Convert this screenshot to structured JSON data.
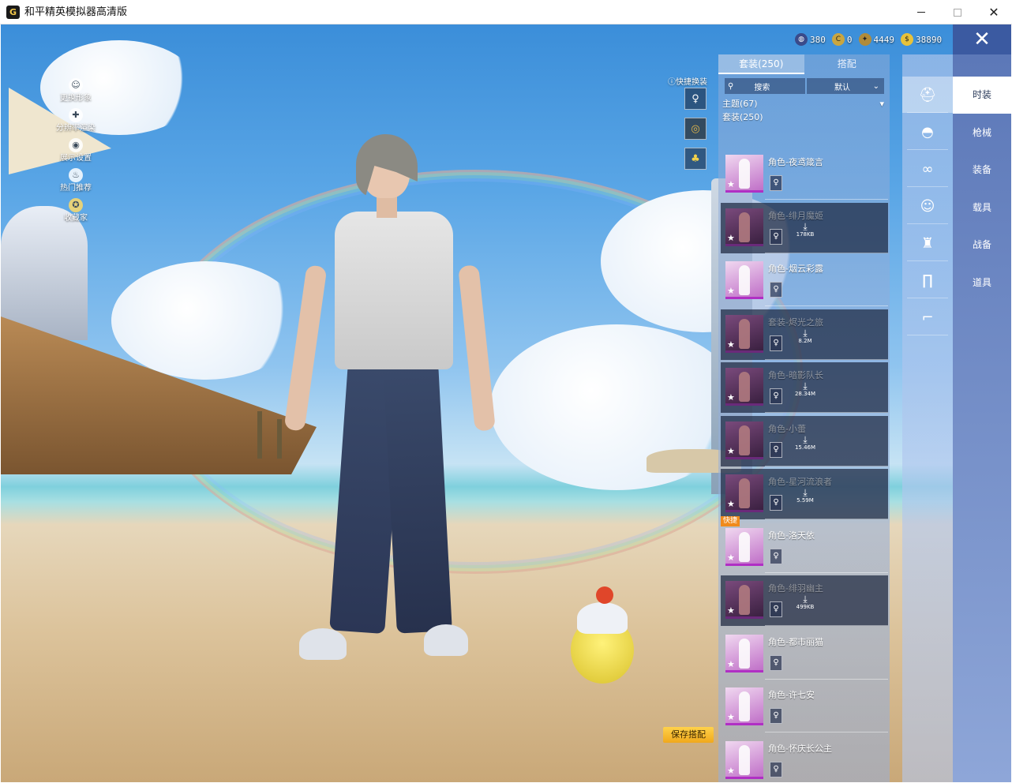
{
  "window": {
    "title": "和平精英模拟器高清版",
    "controls": {
      "minimize": "—",
      "maximize": "",
      "close": "✕"
    }
  },
  "left_menu": [
    {
      "label": "更换形象",
      "icon": "person-icon"
    },
    {
      "label": "分辨率渲染",
      "icon": "puzzle-icon"
    },
    {
      "label": "展示设置",
      "icon": "eye-icon"
    },
    {
      "label": "热门推荐",
      "icon": "flame-icon"
    },
    {
      "label": "收藏家",
      "icon": "collector-badge-icon"
    }
  ],
  "currencies": [
    {
      "value": "380",
      "icon": "globe-coin-icon",
      "color": "#3a4a8a"
    },
    {
      "value": "0",
      "icon": "c-coin-icon",
      "color": "#c9a640"
    },
    {
      "value": "4449",
      "icon": "medal-coin-icon",
      "color": "#b08b3a"
    },
    {
      "value": "38890",
      "icon": "gold-coin-icon",
      "color": "#e8c23a"
    }
  ],
  "quick_change": {
    "label": "快捷换装"
  },
  "panel": {
    "tabs": [
      "套装(250)",
      "搭配"
    ],
    "search_label": "搜索",
    "sort_label": "默认",
    "filter_theme": "主题(67)",
    "filter_suit": "套装(250)"
  },
  "outfits": [
    {
      "name": "角色-夜鸢箴言",
      "downloaded": true,
      "size": ""
    },
    {
      "name": "角色-绯月魔姬",
      "downloaded": false,
      "size": "178KB"
    },
    {
      "name": "角色-烟云彩露",
      "downloaded": true,
      "size": ""
    },
    {
      "name": "套装-烬光之旅",
      "downloaded": false,
      "size": "8.2M"
    },
    {
      "name": "角色-暗影队长",
      "downloaded": false,
      "size": "28.34M"
    },
    {
      "name": "角色-小蕾",
      "downloaded": false,
      "size": "15.46M"
    },
    {
      "name": "角色-星河流浪者",
      "downloaded": false,
      "size": "5.59M"
    },
    {
      "name": "角色-洛天依",
      "downloaded": true,
      "size": "",
      "tag": "快捷"
    },
    {
      "name": "角色-绯羽幽主",
      "downloaded": false,
      "size": "499KB"
    },
    {
      "name": "角色-都市丽猫",
      "downloaded": true,
      "size": ""
    },
    {
      "name": "角色-许七安",
      "downloaded": true,
      "size": ""
    },
    {
      "name": "角色-怀庆长公主",
      "downloaded": true,
      "size": ""
    }
  ],
  "categories": [
    {
      "icon": "hat-brim-icon",
      "active": true
    },
    {
      "icon": "cap-icon",
      "active": false
    },
    {
      "icon": "glasses-icon",
      "active": false
    },
    {
      "icon": "mask-icon",
      "active": false
    },
    {
      "icon": "jacket-icon",
      "active": false
    },
    {
      "icon": "pants-icon",
      "active": false
    },
    {
      "icon": "shoes-icon",
      "active": false
    }
  ],
  "side_tabs": [
    "时装",
    "枪械",
    "装备",
    "载具",
    "战备",
    "道具"
  ],
  "save_button": "保存搭配",
  "colors": {
    "accent": "#3b5aa1",
    "save": "#f0a81c",
    "quick_tag": "#f08a1c",
    "rarity": "#b02fc4"
  }
}
